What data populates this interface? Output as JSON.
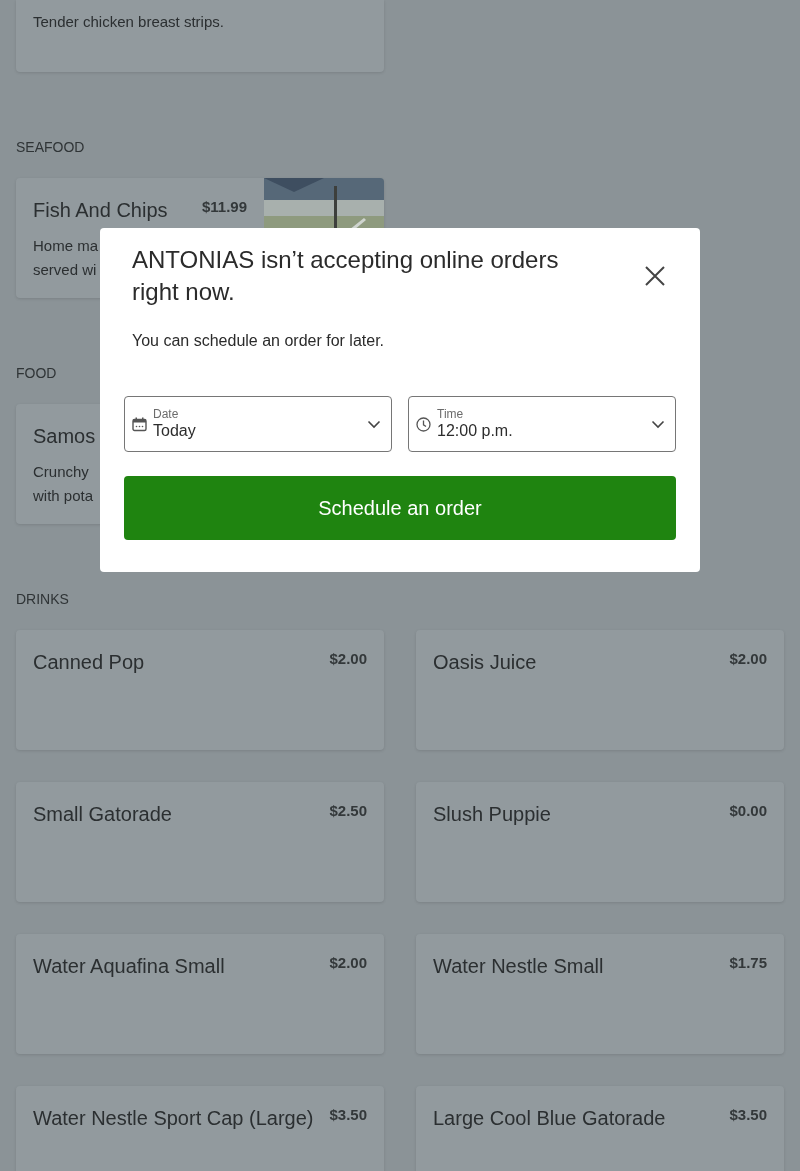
{
  "top_card": {
    "description": "Tender chicken breast strips."
  },
  "sections": [
    {
      "heading": "SEAFOOD",
      "items": [
        {
          "name": "Fish And Chips",
          "price": "$11.99",
          "description_lines": [
            "Home ma",
            "served wi"
          ],
          "image": {
            "kind": "picture"
          }
        }
      ]
    },
    {
      "heading": "FOOD",
      "items": [
        {
          "name": "Samos",
          "description_lines": [
            "Crunchy",
            "with pota"
          ]
        }
      ]
    },
    {
      "heading": "DRINKS",
      "items": [
        {
          "name": "Canned Pop",
          "price": "$2.00"
        },
        {
          "name": "Oasis Juice",
          "price": "$2.00"
        },
        {
          "name": "Small Gatorade",
          "price": "$2.50"
        },
        {
          "name": "Slush Puppie",
          "price": "$0.00"
        },
        {
          "name": "Water Aquafina Small",
          "price": "$2.00"
        },
        {
          "name": "Water Nestle Small",
          "price": "$1.75"
        },
        {
          "name": "Water Nestle Sport Cap (Large)",
          "price": "$3.50"
        },
        {
          "name": "Large Cool Blue Gatorade",
          "price": "$3.50"
        }
      ]
    }
  ],
  "modal": {
    "title": "ANTONIAS isn’t accepting online orders right now.",
    "message": "You can schedule an order for later.",
    "fields": [
      {
        "kind": "date",
        "label": "Date",
        "value": "Today"
      },
      {
        "kind": "time",
        "label": "Time",
        "value": "12:00 p.m."
      }
    ],
    "button": "Schedule an order"
  }
}
